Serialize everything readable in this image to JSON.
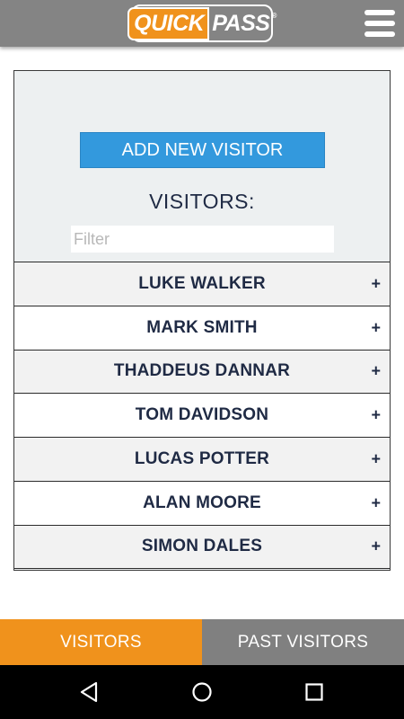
{
  "header": {
    "logo_quick": "QUICK",
    "logo_pass": "PASS",
    "logo_reg": "®",
    "menu_icon": "hamburger-menu-icon"
  },
  "main": {
    "add_button_label": "ADD NEW VISITOR",
    "visitors_heading": "VISITORS:",
    "filter_placeholder": "Filter",
    "filter_value": "",
    "visitors": [
      {
        "name": "LUKE WALKER",
        "expand": "+"
      },
      {
        "name": "MARK SMITH",
        "expand": "+"
      },
      {
        "name": "THADDEUS DANNAR",
        "expand": "+"
      },
      {
        "name": "TOM DAVIDSON",
        "expand": "+"
      },
      {
        "name": "LUCAS POTTER",
        "expand": "+"
      },
      {
        "name": "ALAN MOORE",
        "expand": "+"
      },
      {
        "name": "SIMON DALES",
        "expand": "+"
      }
    ]
  },
  "tabs": [
    {
      "label": "VISITORS",
      "active": true
    },
    {
      "label": "PAST VISITORS",
      "active": false
    }
  ],
  "colors": {
    "accent_orange": "#f0921c",
    "button_blue": "#3399dd",
    "header_gray": "#848484",
    "text_navy": "#1f2a44"
  },
  "system_nav": [
    "back-icon",
    "home-icon",
    "recent-apps-icon"
  ]
}
